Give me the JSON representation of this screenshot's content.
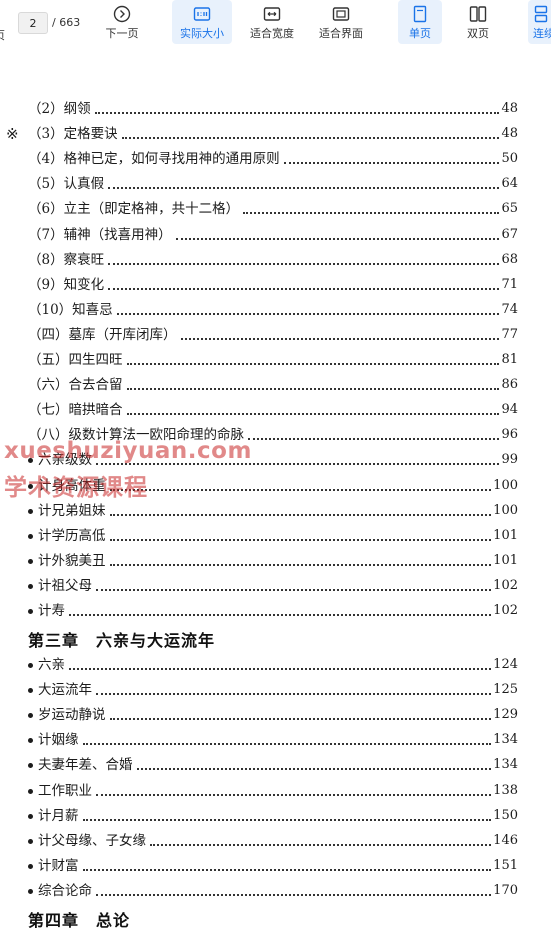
{
  "toolbar": {
    "left_edge_label": "页",
    "current_page": "2",
    "page_separator": "/",
    "total_pages": "663",
    "buttons": [
      {
        "label": "下一页",
        "icon": "chevron-right-circle-icon",
        "active": false
      },
      {
        "label": "实际大小",
        "icon": "actual-size-icon",
        "active": true
      },
      {
        "label": "适合宽度",
        "icon": "fit-width-icon",
        "active": false
      },
      {
        "label": "适合界面",
        "icon": "fit-page-icon",
        "active": false
      },
      {
        "label": "单页",
        "icon": "single-page-icon",
        "active": true
      },
      {
        "label": "双页",
        "icon": "double-page-icon",
        "active": false
      },
      {
        "label": "连续",
        "icon": "continuous-icon",
        "active": true
      }
    ]
  },
  "accent_color": "#1a73e8",
  "toc": [
    {
      "mark": "",
      "bullet": false,
      "text": "（2）纲领",
      "page": "48"
    },
    {
      "mark": "※",
      "bullet": false,
      "text": "（3）定格要诀",
      "page": "48"
    },
    {
      "mark": "",
      "bullet": false,
      "text": "（4）格神已定，如何寻找用神的通用原则",
      "page": "50"
    },
    {
      "mark": "",
      "bullet": false,
      "text": "（5）认真假",
      "page": "64"
    },
    {
      "mark": "",
      "bullet": false,
      "text": "（6）立主（即定格神，共十二格）",
      "page": "65"
    },
    {
      "mark": "",
      "bullet": false,
      "text": "（7）辅神（找喜用神）",
      "page": "67"
    },
    {
      "mark": "",
      "bullet": false,
      "text": "（8）察衰旺",
      "page": "68"
    },
    {
      "mark": "",
      "bullet": false,
      "text": "（9）知变化",
      "page": "71"
    },
    {
      "mark": "",
      "bullet": false,
      "text": "（10）知喜忌",
      "page": "74"
    },
    {
      "mark": "",
      "bullet": false,
      "text": "（四）墓库（开库闭库）",
      "page": "77"
    },
    {
      "mark": "",
      "bullet": false,
      "text": "（五）四生四旺",
      "page": "81"
    },
    {
      "mark": "",
      "bullet": false,
      "text": "（六）合去合留",
      "page": "86"
    },
    {
      "mark": "",
      "bullet": false,
      "text": "（七）暗拱暗合",
      "page": "94"
    },
    {
      "mark": "",
      "bullet": false,
      "text": "（八）级数计算法一欧阳命理的命脉",
      "page": "96"
    },
    {
      "mark": "",
      "bullet": true,
      "text": "六亲级数",
      "page": "99"
    },
    {
      "mark": "",
      "bullet": true,
      "text": "计身高体重",
      "page": "100"
    },
    {
      "mark": "",
      "bullet": true,
      "text": "计兄弟姐妹",
      "page": "100"
    },
    {
      "mark": "",
      "bullet": true,
      "text": "计学历高低",
      "page": "101"
    },
    {
      "mark": "",
      "bullet": true,
      "text": "计外貌美丑",
      "page": "101"
    },
    {
      "mark": "",
      "bullet": true,
      "text": "计祖父母",
      "page": "102"
    },
    {
      "mark": "",
      "bullet": true,
      "text": "计寿",
      "page": "102"
    }
  ],
  "chapter3": "第三章　六亲与大运流年",
  "toc2": [
    {
      "bullet": true,
      "text": "六亲",
      "page": "124"
    },
    {
      "bullet": true,
      "text": "大运流年",
      "page": "125"
    },
    {
      "bullet": true,
      "text": "岁运动静说",
      "page": "129"
    },
    {
      "bullet": true,
      "text": "计姻缘",
      "page": "134"
    },
    {
      "bullet": true,
      "text": "夫妻年差、合婚",
      "page": "134"
    },
    {
      "bullet": true,
      "text": "工作职业",
      "page": "138"
    },
    {
      "bullet": true,
      "text": "计月薪",
      "page": "150"
    },
    {
      "bullet": true,
      "text": "计父母缘、子女缘",
      "page": "146"
    },
    {
      "bullet": true,
      "text": "计财富",
      "page": "151"
    },
    {
      "bullet": true,
      "text": "综合论命",
      "page": "170"
    }
  ],
  "chapter4": "第四章　总论",
  "watermark": {
    "line1": "xueshuziyuan.com",
    "line2": "学术资源课程",
    "color": "#c82828"
  }
}
